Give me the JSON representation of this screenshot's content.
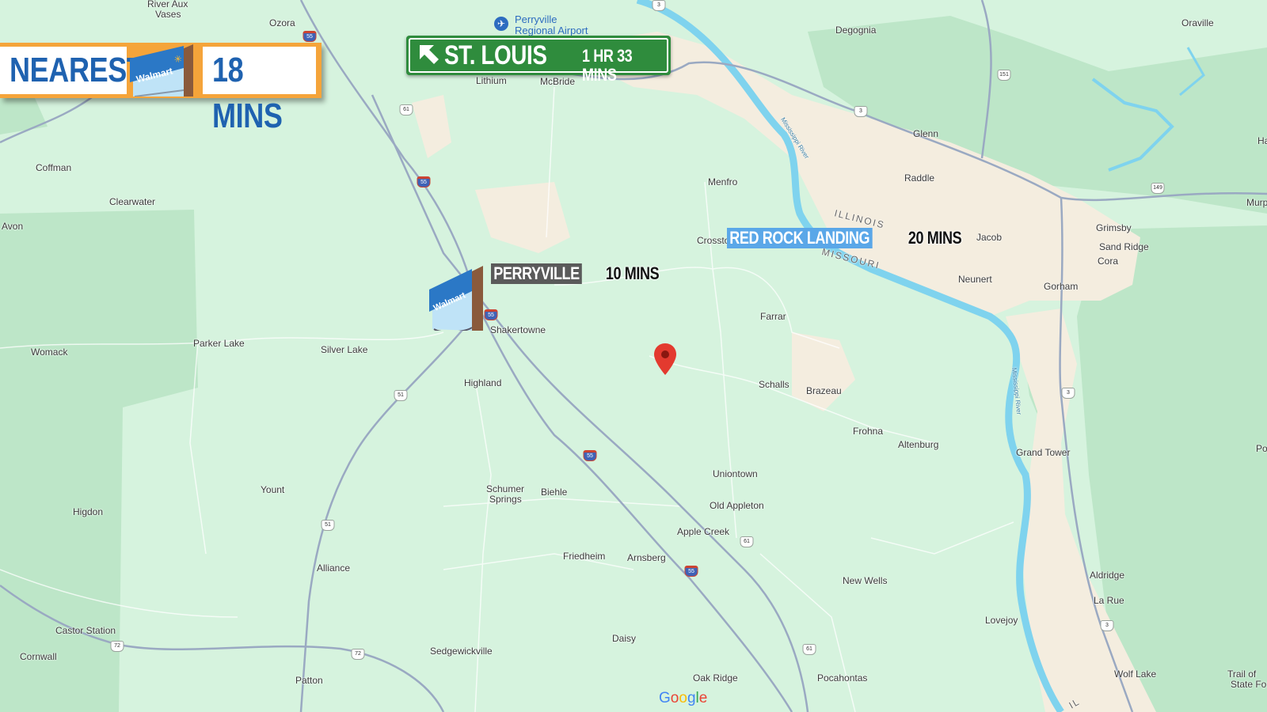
{
  "banner": {
    "nearest_label": "NEAREST",
    "nearest_time": "18 MINS",
    "logo_text": "Walmart"
  },
  "st_louis_sign": {
    "city": "ST. LOUIS",
    "duration": "1 HR 33 MINS",
    "arrow_icon": "up-left-arrow-icon",
    "color": "#2f8c3d"
  },
  "perryville_tag": {
    "label": "PERRYVILLE",
    "time": "10 MINS",
    "logo_text": "Walmart"
  },
  "red_rock_tag": {
    "label": "RED ROCK LANDING",
    "time": "20 MINS",
    "color": "#5aa7e8"
  },
  "airport": {
    "name_line1": "Perryville",
    "name_line2": "Regional Airport",
    "icon": "airplane-icon"
  },
  "places": {
    "river_aux_vases_1": "River Aux",
    "river_aux_vases_2": "Vases",
    "ozora": "Ozora",
    "degognia": "Degognia",
    "oraville": "Oraville",
    "lithium": "Lithium",
    "mcbride": "McBride",
    "glenn": "Glenn",
    "raddle": "Raddle",
    "coffman": "Coffman",
    "clearwater": "Clearwater",
    "avon": "Avon",
    "menfro": "Menfro",
    "crosstown": "Crossto",
    "jacob": "Jacob",
    "grimsby": "Grimsby",
    "sand_ridge": "Sand Ridge",
    "cora": "Cora",
    "neunert": "Neunert",
    "gorham": "Gorham",
    "shakertowne": "Shakertowne",
    "farrar": "Farrar",
    "womack": "Womack",
    "parker_lake": "Parker Lake",
    "silver_lake": "Silver Lake",
    "highland": "Highland",
    "schalls": "Schalls",
    "brazeau": "Brazeau",
    "frohna": "Frohna",
    "altenburg": "Altenburg",
    "grand_tower": "Grand Tower",
    "uniontown": "Uniontown",
    "yount": "Yount",
    "schumer_1": "Schumer",
    "schumer_2": "Springs",
    "biehle": "Biehle",
    "higdon": "Higdon",
    "old_appleton": "Old Appleton",
    "apple_creek": "Apple Creek",
    "friedheim": "Friedheim",
    "arnsberg": "Arnsberg",
    "alliance": "Alliance",
    "new_wells": "New Wells",
    "aldridge": "Aldridge",
    "la_rue": "La Rue",
    "lovejoy": "Lovejoy",
    "castor_station": "Castor Station",
    "cornwall": "Cornwall",
    "sedgewickville": "Sedgewickville",
    "daisy": "Daisy",
    "patton": "Patton",
    "oak_ridge": "Oak Ridge",
    "pocahontas": "Pocahontas",
    "wolf_lake": "Wolf Lake",
    "trail_1": "Trail of",
    "trail_2": "State Fo",
    "murp": "Murp",
    "ha": "Ha",
    "po": "Po",
    "illinois": "ILLINOIS",
    "missouri": "MISSOURI",
    "river_1": "Mississippi River",
    "river_2": "Mississippi River",
    "il_edge": "IL"
  },
  "shields": {
    "i55_a": "55",
    "i55_b": "55",
    "i55_c": "55",
    "i55_d": "55",
    "i55_e": "55",
    "us61_a": "61",
    "us61_b": "61",
    "us61_c": "61",
    "r51_a": "51",
    "r51_b": "51",
    "r72_a": "72",
    "r72_b": "72",
    "r3_a": "3",
    "r3_b": "3",
    "r3_c": "3",
    "r3_d": "3",
    "r151": "151",
    "r149": "149"
  },
  "google_logo": "Google",
  "colors": {
    "land": "#d6f3de",
    "park": "#bde6c8",
    "river": "#7fd3ee",
    "floodplain": "#f3ecdd",
    "road": "#9aa9c2",
    "banner_orange": "#f5a43a",
    "banner_blue": "#1f62b0",
    "pin": "#e33a2f"
  }
}
